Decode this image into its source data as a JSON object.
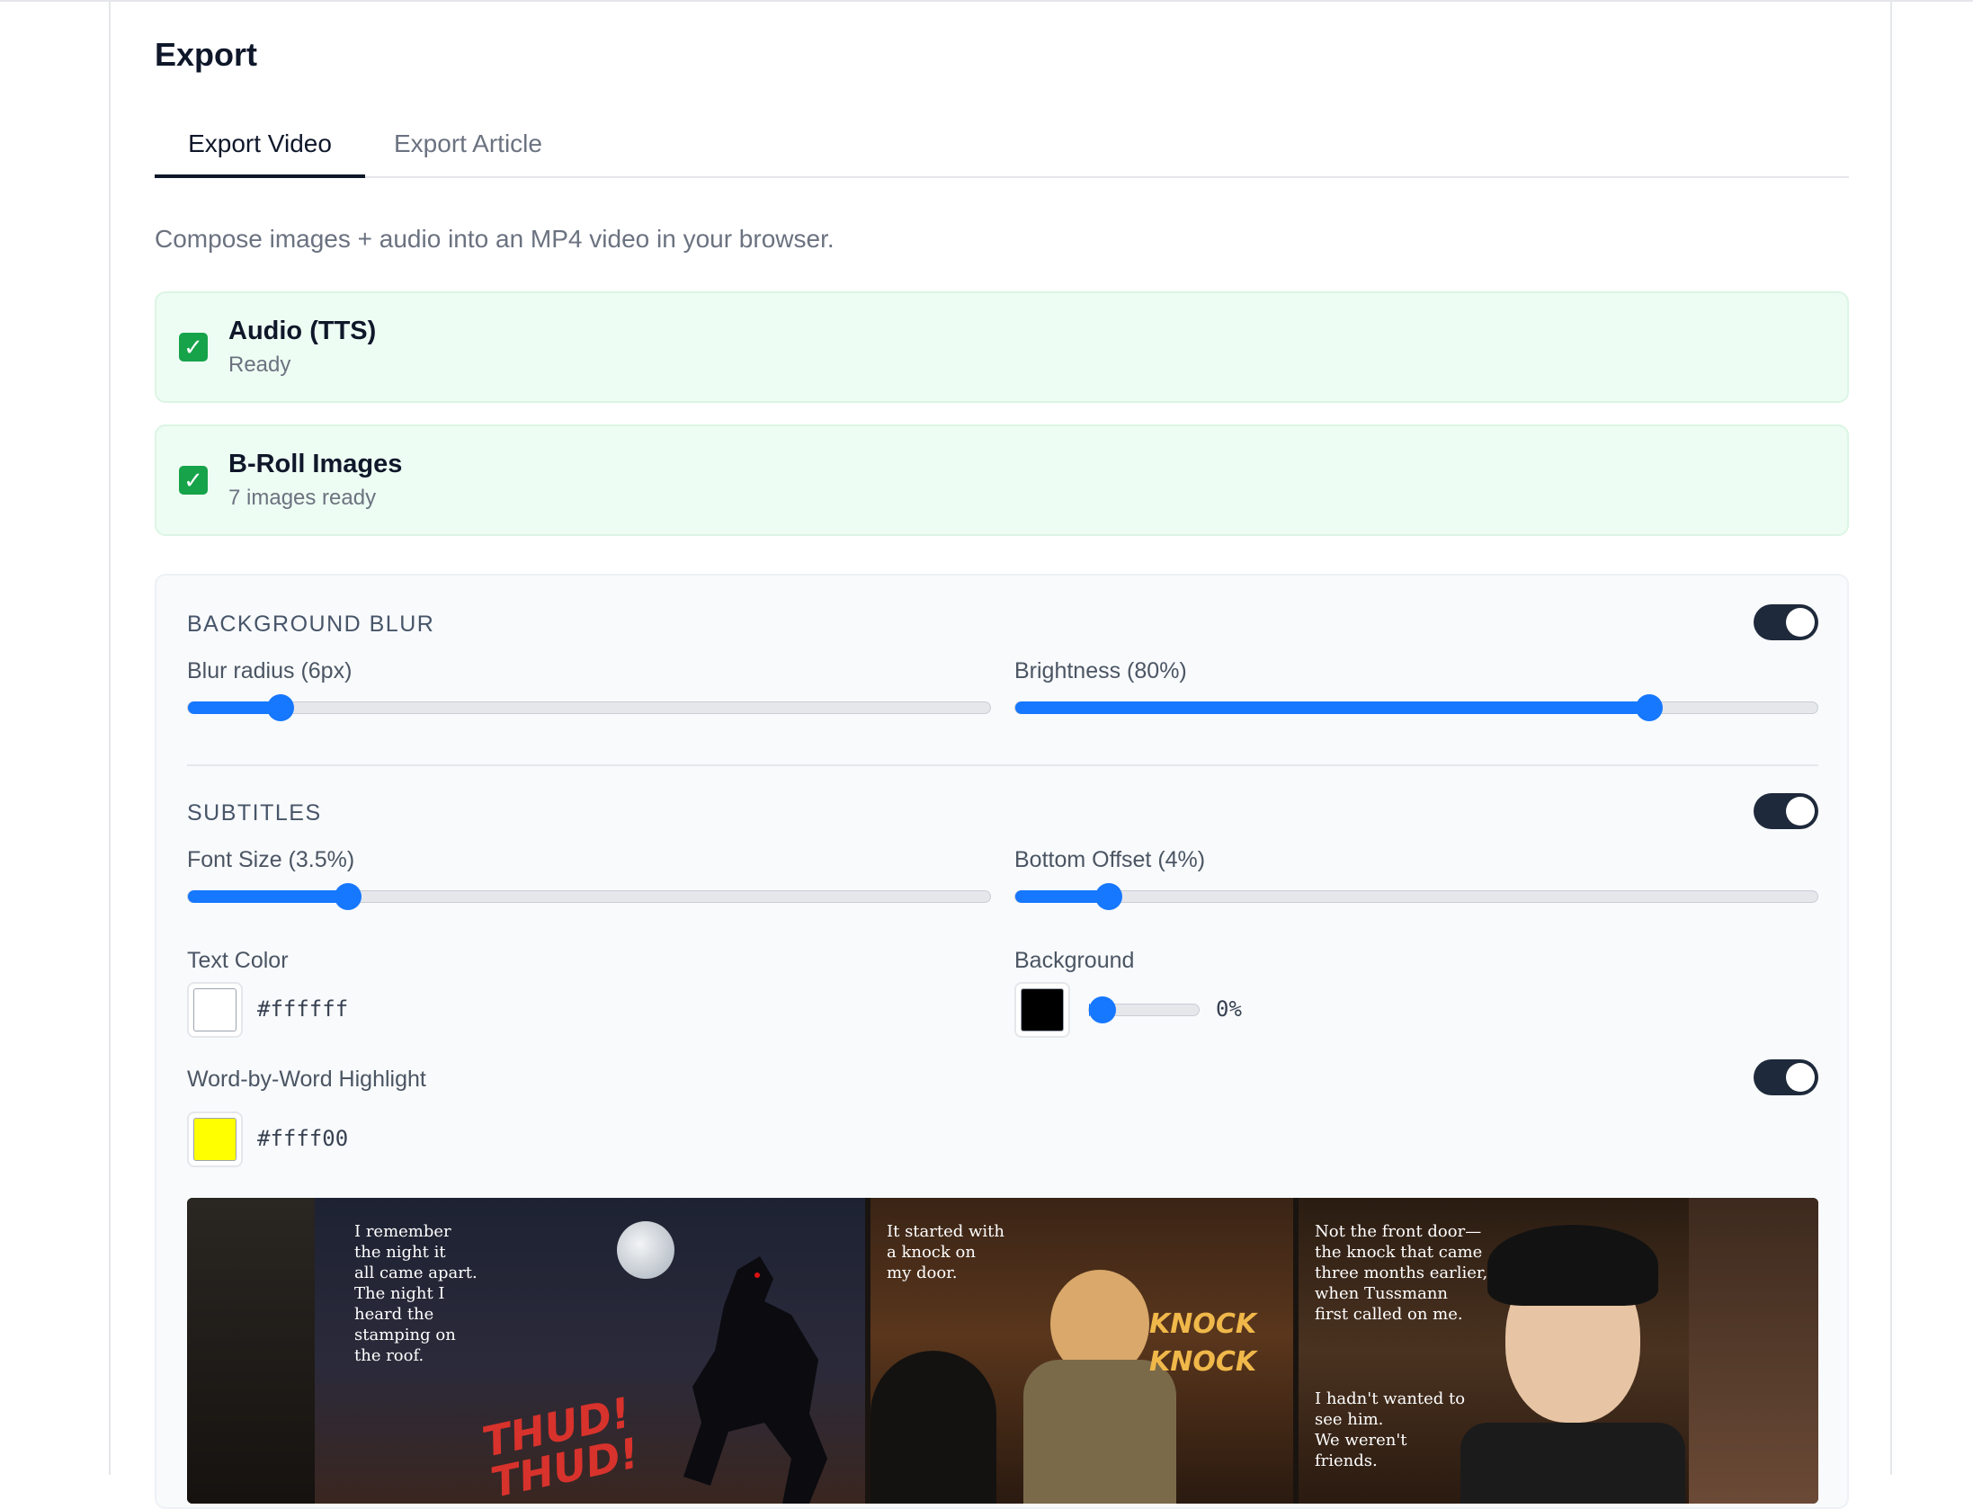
{
  "header": {
    "title": "Export"
  },
  "tabs": [
    {
      "label": "Export Video",
      "active": true
    },
    {
      "label": "Export Article",
      "active": false
    }
  ],
  "description": "Compose images + audio into an MP4 video in your browser.",
  "status_items": [
    {
      "title": "Audio (TTS)",
      "subtitle": "Ready",
      "icon": "check-icon",
      "color": "#16a34a"
    },
    {
      "title": "B-Roll Images",
      "subtitle": "7 images ready",
      "icon": "check-icon",
      "color": "#16a34a"
    }
  ],
  "background_blur": {
    "label": "BACKGROUND BLUR",
    "enabled": true,
    "blur_radius": {
      "label": "Blur radius (6px)",
      "value": 0.115
    },
    "brightness": {
      "label": "Brightness (80%)",
      "value": 0.79
    }
  },
  "subtitles": {
    "label": "SUBTITLES",
    "enabled": true,
    "font_size": {
      "label": "Font Size (3.5%)",
      "value": 0.2
    },
    "bottom_offset": {
      "label": "Bottom Offset (4%)",
      "value": 0.117
    },
    "text_color": {
      "label": "Text Color",
      "hex": "#ffffff"
    },
    "background": {
      "label": "Background",
      "hex": "#000000",
      "opacity_value": 0,
      "opacity_text": "0%"
    },
    "word_highlight": {
      "label": "Word-by-Word Highlight",
      "enabled": true,
      "hex": "#ffff00"
    }
  },
  "preview": {
    "panel1_caption": "I remember\nthe night it\nall came apart.\nThe night I\nheard the\nstamping on\nthe roof.",
    "panel1_sfx": "THUD! THUD!",
    "panel2_caption": "It started with\na knock on\nmy door.",
    "panel2_sfx": "KNOCK KNOCK",
    "panel3_caption_top": "Not the front door—\nthe knock that came\nthree months earlier,\nwhen Tussmann\nfirst called on me.",
    "panel3_caption_bottom": "I hadn't wanted to\nsee him.\nWe weren't\nfriends."
  },
  "colors": {
    "accent": "#1677ff",
    "toggle_on": "#1e293b",
    "success_bg": "#eefdf3"
  }
}
